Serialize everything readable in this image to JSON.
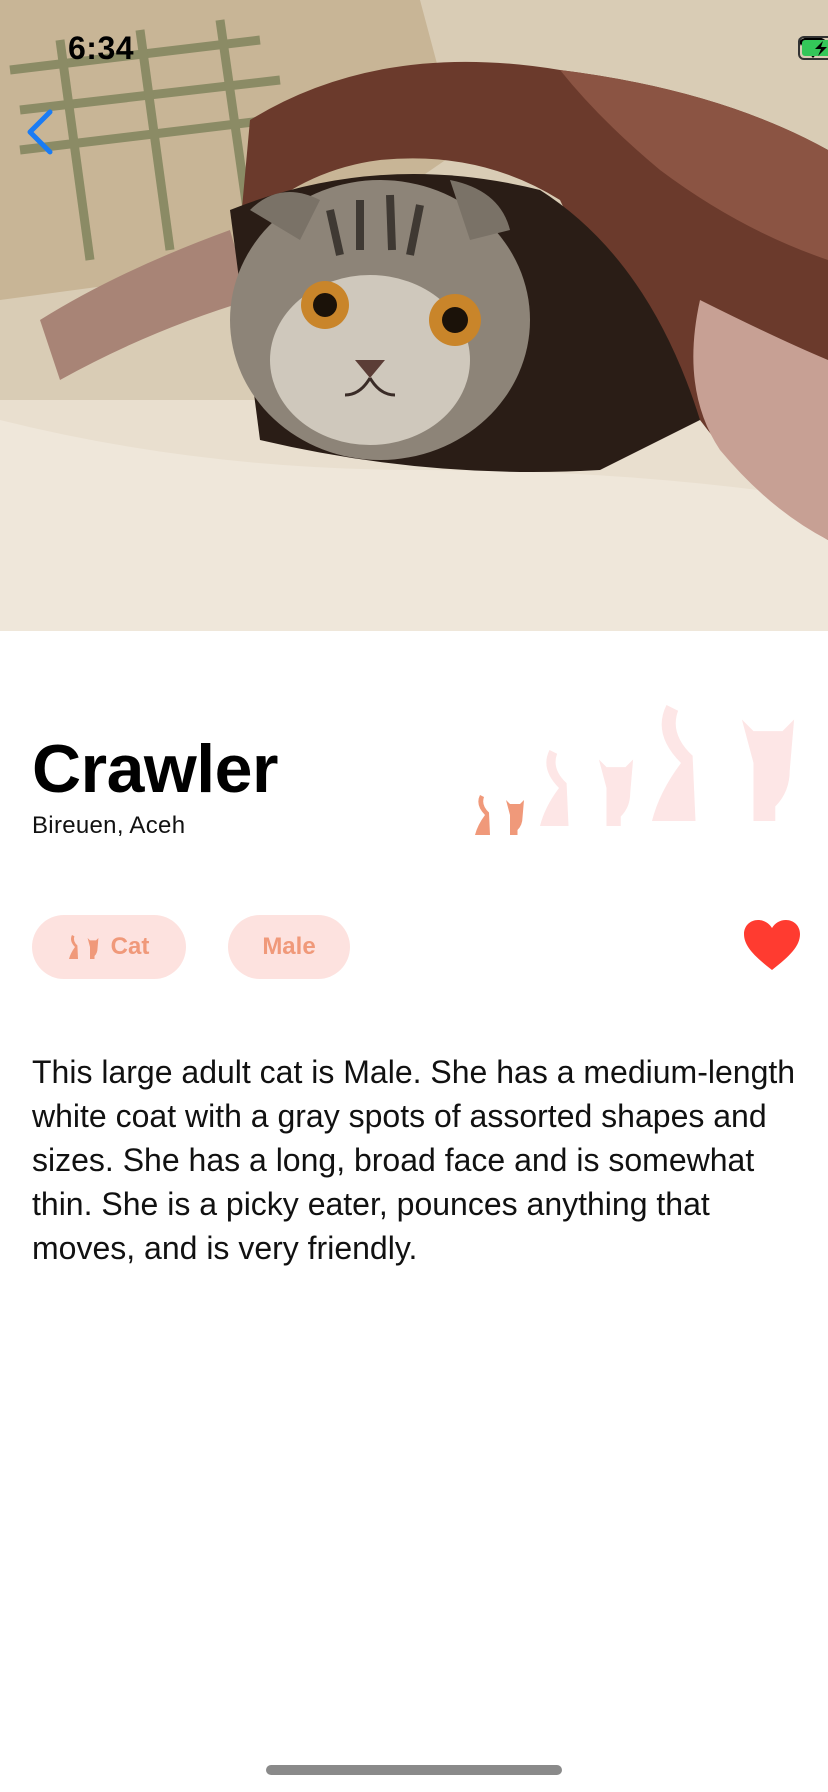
{
  "status_bar": {
    "time": "6:34"
  },
  "pet": {
    "name": "Crawler",
    "location": "Bireuen, Aceh",
    "type_label": "Cat",
    "gender_label": "Male",
    "size": "small",
    "favorite": true,
    "description": "This large adult cat is Male.  She has a medium-length white coat with a gray spots of assorted shapes and sizes.  She has a long, broad face and is somewhat thin.  She is a picky eater, pounces anything that moves, and is very friendly."
  },
  "icons": {
    "back": "chevron-left-icon",
    "cat": "cat-icon",
    "favorite": "heart-icon",
    "wifi": "wifi-icon",
    "battery": "battery-charging-icon",
    "signal": "cellular-signal-icon"
  },
  "colors": {
    "accent": "#f0997a",
    "chip_background": "#fde2df",
    "size_inactive": "#fde6e6",
    "size_active": "#f0997a",
    "favorite": "#ff3b30",
    "back": "#1a7cf5"
  }
}
